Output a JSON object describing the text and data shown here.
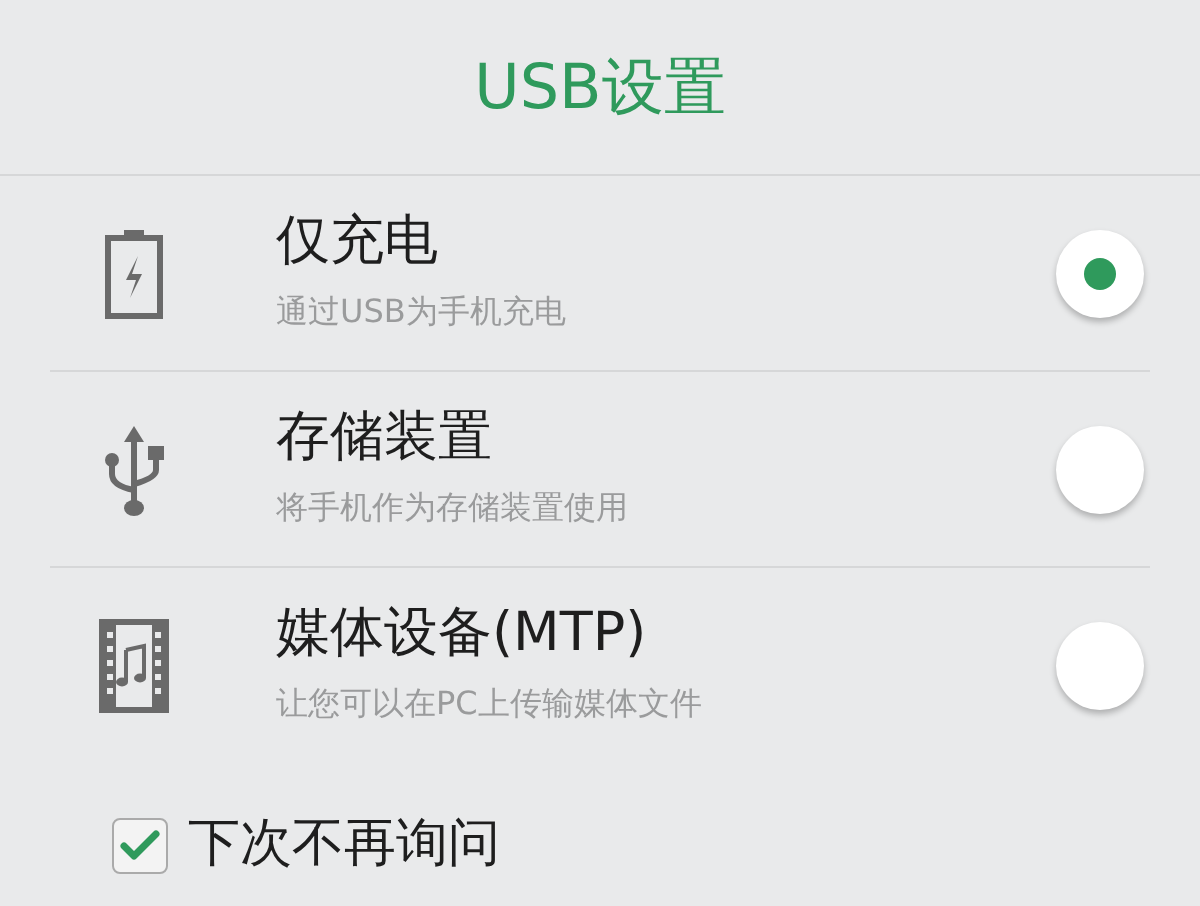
{
  "dialog": {
    "title": "USB设置"
  },
  "options": [
    {
      "label": "仅充电",
      "description": "通过USB为手机充电",
      "selected": true
    },
    {
      "label": "存储装置",
      "description": "将手机作为存储装置使用",
      "selected": false
    },
    {
      "label": "媒体设备(MTP)",
      "description": "让您可以在PC上传输媒体文件",
      "selected": false
    }
  ],
  "remember": {
    "label": "下次不再询问",
    "checked": true
  }
}
